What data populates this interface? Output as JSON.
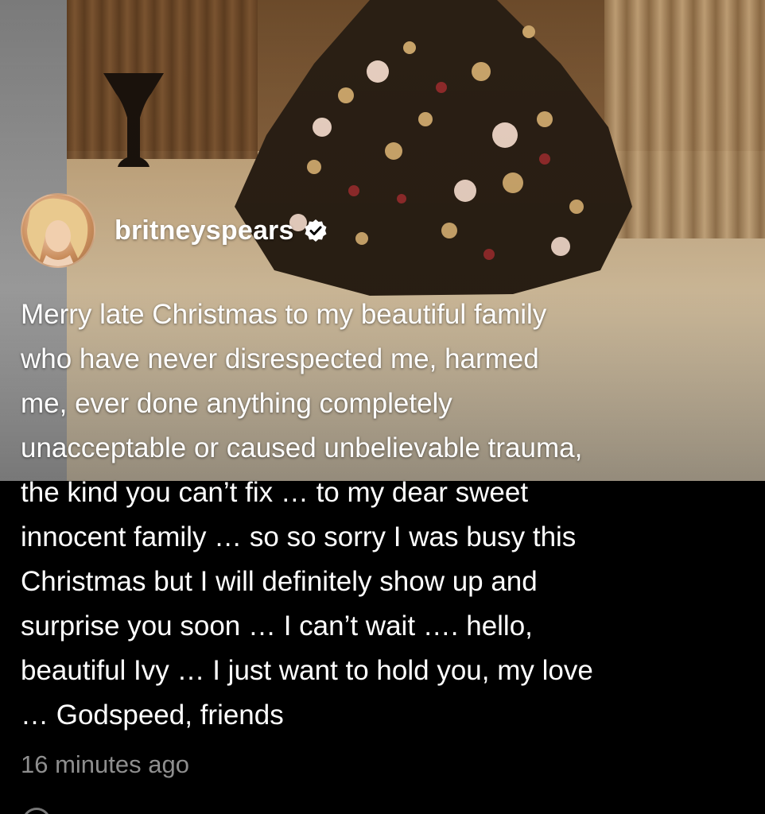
{
  "post": {
    "username": "britneyspears",
    "verified_icon": "verified-badge-icon",
    "caption_lines": [
      "Merry late Christmas to my beautiful family",
      "who have never disrespected me, harmed",
      "me, ever done anything completely",
      "unacceptable or caused unbelievable trauma,",
      "the kind you can’t fix … to my dear sweet",
      "innocent family … so so sorry I was busy this",
      "Christmas but I will definitely show up and",
      "surprise you soon …  I can’t wait …. hello,",
      "beautiful Ivy … I just want to hold you, my love",
      "… Godspeed, friends"
    ],
    "timestamp": "16 minutes ago"
  },
  "colors": {
    "background": "#000000",
    "text": "#ffffff",
    "timestamp": "#8e8e8e"
  }
}
